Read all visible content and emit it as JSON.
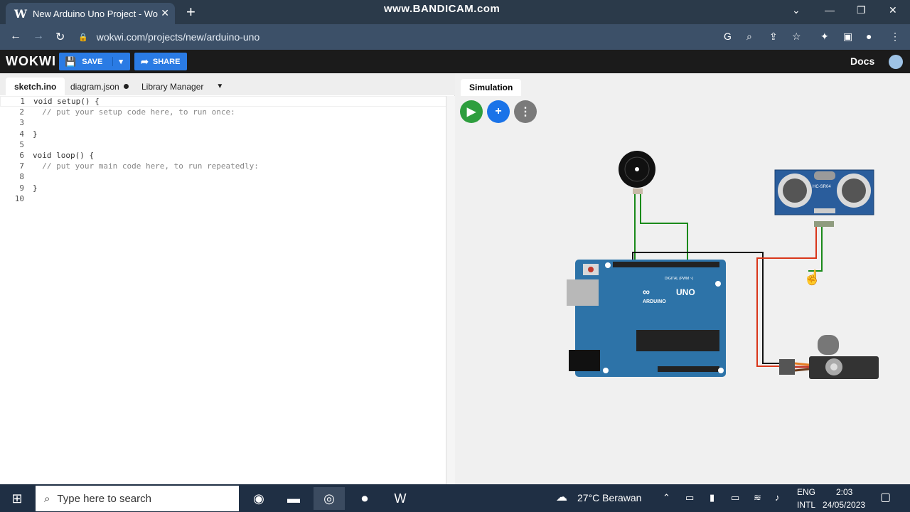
{
  "browser": {
    "tab_title": "New Arduino Uno Project - Wokwi",
    "url": "wokwi.com/projects/new/arduino-uno",
    "recorder": "www.BANDICAM.com"
  },
  "wokwi": {
    "logo": "WOKWI",
    "save": "SAVE",
    "share": "SHARE",
    "docs": "Docs"
  },
  "editor": {
    "tabs": [
      "sketch.ino",
      "diagram.json",
      "Library Manager"
    ],
    "lines": [
      {
        "n": "1",
        "t": "void setup() {"
      },
      {
        "n": "2",
        "t": "  // put your setup code here, to run once:"
      },
      {
        "n": "3",
        "t": ""
      },
      {
        "n": "4",
        "t": "}"
      },
      {
        "n": "5",
        "t": ""
      },
      {
        "n": "6",
        "t": "void loop() {"
      },
      {
        "n": "7",
        "t": "  // put your main code here, to run repeatedly:"
      },
      {
        "n": "8",
        "t": ""
      },
      {
        "n": "9",
        "t": "}"
      },
      {
        "n": "10",
        "t": ""
      }
    ]
  },
  "simulation": {
    "tab": "Simulation",
    "uno_label": "UNO",
    "arduino_label": "ARDUINO",
    "sensor_label": "HC-SR04",
    "digital_label": "DIGITAL (PWM ~)"
  },
  "taskbar": {
    "search_placeholder": "Type here to search",
    "weather": "27°C  Berawan",
    "lang1": "ENG",
    "lang2": "INTL",
    "time": "2:03",
    "date": "24/05/2023"
  }
}
